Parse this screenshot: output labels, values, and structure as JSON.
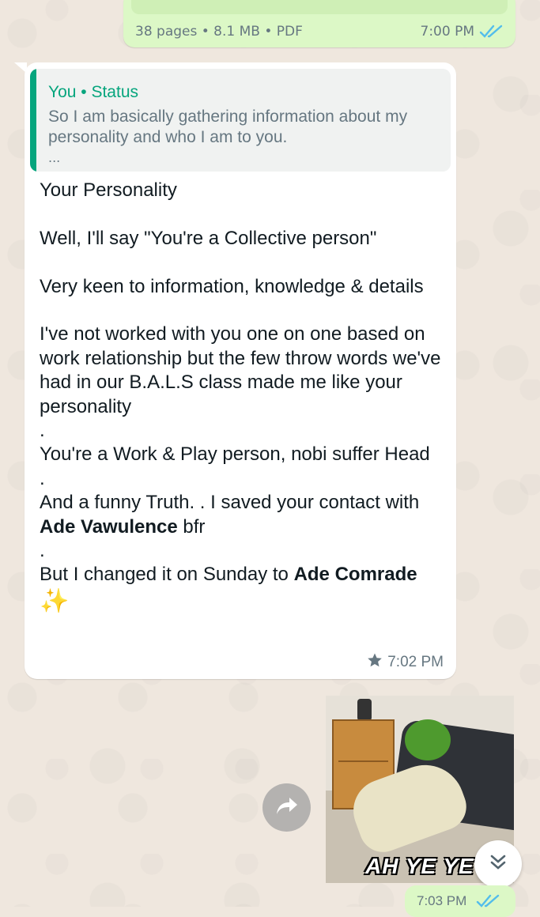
{
  "doc_message": {
    "meta": "38 pages • 8.1 MB • PDF",
    "time": "7:00 PM",
    "status_icon": "double-check-read-icon"
  },
  "reply_message": {
    "quote": {
      "author": "You • Status",
      "text": "So I am basically gathering information about my personality and who I am to you.",
      "more": "..."
    },
    "lines": [
      "Your Personality",
      "",
      "Well, I'll say \"You're a Collective person\"",
      "",
      "Very keen to information, knowledge & details",
      "",
      "I've not worked with you one on one based on work relationship but the few throw words we've had in our B.A.L.S class made me like your personality",
      ".",
      "You're a Work & Play person, nobi suffer Head",
      ".",
      "And a funny Truth. . I saved your contact with ",
      ".",
      "But I changed it on Sunday to "
    ],
    "bold_name_1": "Ade Vawulence",
    "after_name_1": " bfr",
    "bold_name_2": "Ade Comrade",
    "sparkle": "✨",
    "time": "7:02 PM",
    "star_icon": "star-icon"
  },
  "sticker": {
    "caption": "AH YE YE"
  },
  "last_message": {
    "time": "7:03 PM",
    "status_icon": "double-check-read-icon"
  },
  "colors": {
    "background": "#EFE7DE",
    "outgoing_bubble": "#DCF8C6",
    "incoming_bubble": "#FFFFFF",
    "quote_accent": "#06A57D",
    "read_ticks": "#53BDEB",
    "meta_text": "#667781"
  }
}
